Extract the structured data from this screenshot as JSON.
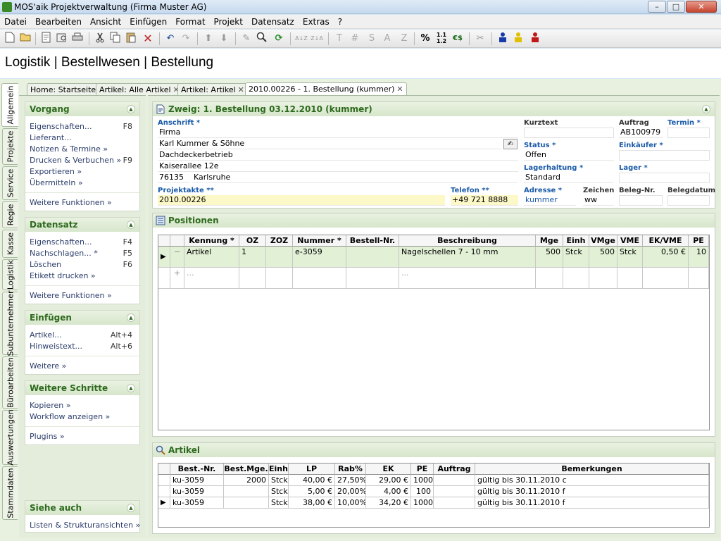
{
  "window": {
    "title": "MOS'aik Projektverwaltung (Firma Muster AG)",
    "btn_min": "–",
    "btn_max": "□",
    "btn_close": "✕"
  },
  "menu": [
    "Datei",
    "Bearbeiten",
    "Ansicht",
    "Einfügen",
    "Format",
    "Projekt",
    "Datensatz",
    "Extras",
    "?"
  ],
  "toolbar": {
    "bold": "T",
    "hash": "#",
    "s": "S",
    "a": "A",
    "z": "Z",
    "percent": "%",
    "euro": "€$",
    "sortaz": "A↓Z",
    "sortza": "Z↓A"
  },
  "breadcrumb": "Logistik | Bestellwesen | Bestellung",
  "vtabs": [
    "Allgemein",
    "Projekte",
    "Service",
    "Regie",
    "Kasse",
    "Logistik",
    "Subunternehmer",
    "Büroarbeiten",
    "Auswertungen",
    "Stammdaten"
  ],
  "doc_tabs": [
    "Home: Startseite",
    "Artikel: Alle Artikel",
    "Artikel: Artikel",
    "2010.00226 - 1. Bestellung (kummer)"
  ],
  "left": {
    "vorgang": {
      "title": "Vorgang",
      "items": [
        {
          "label": "Eigenschaften...",
          "key": "F8"
        },
        {
          "label": "Lieferant...",
          "key": ""
        },
        {
          "label": "Notizen & Termine »",
          "key": ""
        },
        {
          "label": "Drucken & Verbuchen »",
          "key": "F9"
        },
        {
          "label": "Exportieren »",
          "key": ""
        },
        {
          "label": "Übermitteln »",
          "key": ""
        }
      ],
      "more": "Weitere Funktionen »"
    },
    "datensatz": {
      "title": "Datensatz",
      "items": [
        {
          "label": "Eigenschaften...",
          "key": "F4"
        },
        {
          "label": "Nachschlagen... *",
          "key": "F5"
        },
        {
          "label": "Löschen",
          "key": "F6"
        },
        {
          "label": "Etikett drucken »",
          "key": ""
        }
      ],
      "more": "Weitere Funktionen »"
    },
    "einfuegen": {
      "title": "Einfügen",
      "items": [
        {
          "label": "Artikel...",
          "key": "Alt+4"
        },
        {
          "label": "Hinweistext...",
          "key": "Alt+6"
        }
      ],
      "more": "Weitere »"
    },
    "schritte": {
      "title": "Weitere Schritte",
      "items": [
        {
          "label": "Kopieren »",
          "key": ""
        },
        {
          "label": "Workflow anzeigen »",
          "key": ""
        }
      ],
      "more": "Plugins »"
    },
    "siehe": {
      "title": "Siehe auch",
      "items": [
        {
          "label": "Listen & Strukturansichten »",
          "key": ""
        }
      ]
    }
  },
  "zweig": {
    "title": "Zweig: 1. Bestellung 03.12.2010 (kummer)",
    "labels": {
      "anschrift": "Anschrift *",
      "kurztext": "Kurztext",
      "auftrag": "Auftrag",
      "termin": "Termin *",
      "status": "Status *",
      "einkaeufer": "Einkäufer *",
      "lagerhaltung": "Lagerhaltung *",
      "lager": "Lager *",
      "projektakte": "Projektakte **",
      "telefon": "Telefon **",
      "adresse": "Adresse *",
      "zeichen": "Zeichen",
      "belegnr": "Beleg-Nr.",
      "belegdatum": "Belegdatum"
    },
    "values": {
      "firma": "Firma",
      "name": "Karl Kummer & Söhne",
      "zusatz": "Dachdeckerbetrieb",
      "strasse": "Kaiserallee 12e",
      "plz": "76135",
      "ort": "Karlsruhe",
      "kurztext": "",
      "auftrag": "AB100979",
      "termin": "",
      "status": "Offen",
      "einkaeufer": "",
      "lagerhaltung": "Standard",
      "lager": "",
      "projektakte": "2010.00226",
      "telefon": "+49 721 8888",
      "adresse": "kummer",
      "zeichen": "ww",
      "belegnr": "",
      "belegdatum": ""
    }
  },
  "positionen": {
    "title": "Positionen",
    "columns": [
      "Kennung *",
      "OZ",
      "ZOZ",
      "Nummer *",
      "Bestell-Nr.",
      "Beschreibung",
      "Mge",
      "Einh",
      "VMge",
      "VME",
      "EK/VME",
      "PE"
    ],
    "rows": [
      [
        "Artikel",
        "1",
        "",
        "e-3059",
        "",
        "Nagelschellen 7 - 10 mm",
        "500",
        "Stck",
        "500",
        "Stck",
        "0,50 €",
        "10"
      ],
      [
        "...",
        "",
        "",
        "",
        "",
        "...",
        "",
        "",
        "",
        "",
        "",
        ""
      ]
    ],
    "plus": "+",
    "expand": "−"
  },
  "artikel": {
    "title": "Artikel",
    "columns": [
      "Best.-Nr.",
      "Best.Mge.",
      "Einh",
      "LP",
      "Rab%",
      "EK",
      "PE",
      "Auftrag",
      "Bemerkungen"
    ],
    "rows": [
      [
        "ku-3059",
        "2000",
        "Stck",
        "40,00 €",
        "27,50%",
        "29,00 €",
        "1000",
        "",
        "gültig bis 30.11.2010 c"
      ],
      [
        "ku-3059",
        "",
        "Stck",
        "5,00 €",
        "20,00%",
        "4,00 €",
        "100",
        "",
        "gültig bis 30.11.2010 f"
      ],
      [
        "ku-3059",
        "",
        "Stck",
        "38,00 €",
        "10,00%",
        "34,20 €",
        "1000",
        "",
        "gültig bis 30.11.2010 f"
      ]
    ]
  },
  "colors": {
    "accent_green": "#2e6a1e",
    "required_blue": "#1a5aa8",
    "highlight_row": "#e2f0d6",
    "yellow_field": "#fdf8c8"
  }
}
